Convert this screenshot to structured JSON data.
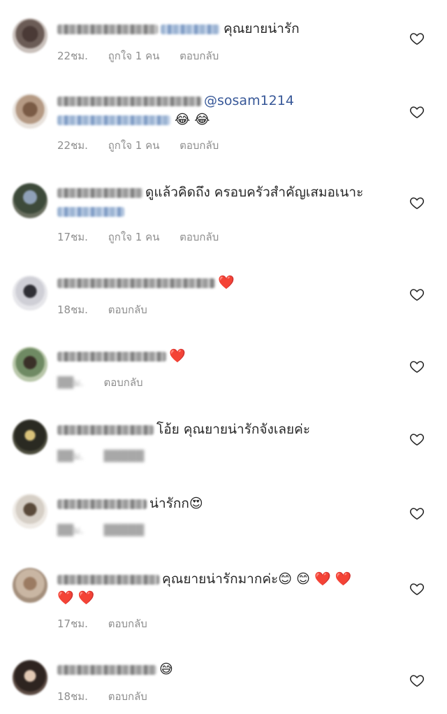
{
  "comments": [
    {
      "text": "คุณยายน่ารัก",
      "time": "22ชม.",
      "likes": "ถูกใจ 1 คน",
      "reply": "ตอบกลับ"
    },
    {
      "mention": "@sosam1214",
      "emoji": "😂 😂",
      "time": "22ชม.",
      "likes": "ถูกใจ 1 คน",
      "reply": "ตอบกลับ"
    },
    {
      "text": "ดูแล้วคิดถึง ครอบครัวสำคัญเสมอเนาะ",
      "time": "17ชม.",
      "likes": "ถูกใจ 1 คน",
      "reply": "ตอบกลับ"
    },
    {
      "emoji": "❤️",
      "time": "18ชม.",
      "reply": "ตอบกลับ"
    },
    {
      "emoji": "❤️",
      "time": "",
      "reply": "ตอบกลับ"
    },
    {
      "text": "โอ้ย คุณยายน่ารักจังเลยค่ะ",
      "time": "",
      "reply": ""
    },
    {
      "text": "น่ารักก",
      "emoji": "😍",
      "time": "",
      "reply": ""
    },
    {
      "text": "คุณยายน่ารักมากค่ะ",
      "emoji": "😊 😊 ❤️ ❤️",
      "emoji2": "❤️ ❤️",
      "time": "17ชม.",
      "reply": "ตอบกลับ"
    },
    {
      "emoji": "😅",
      "time": "18ชม.",
      "reply": "ตอบกลับ"
    }
  ],
  "icons": {
    "like": "heart-outline-icon"
  },
  "colors": {
    "text": "#262626",
    "meta": "#8e8e8e",
    "mention": "#385898",
    "heart_stroke": "#262626"
  }
}
